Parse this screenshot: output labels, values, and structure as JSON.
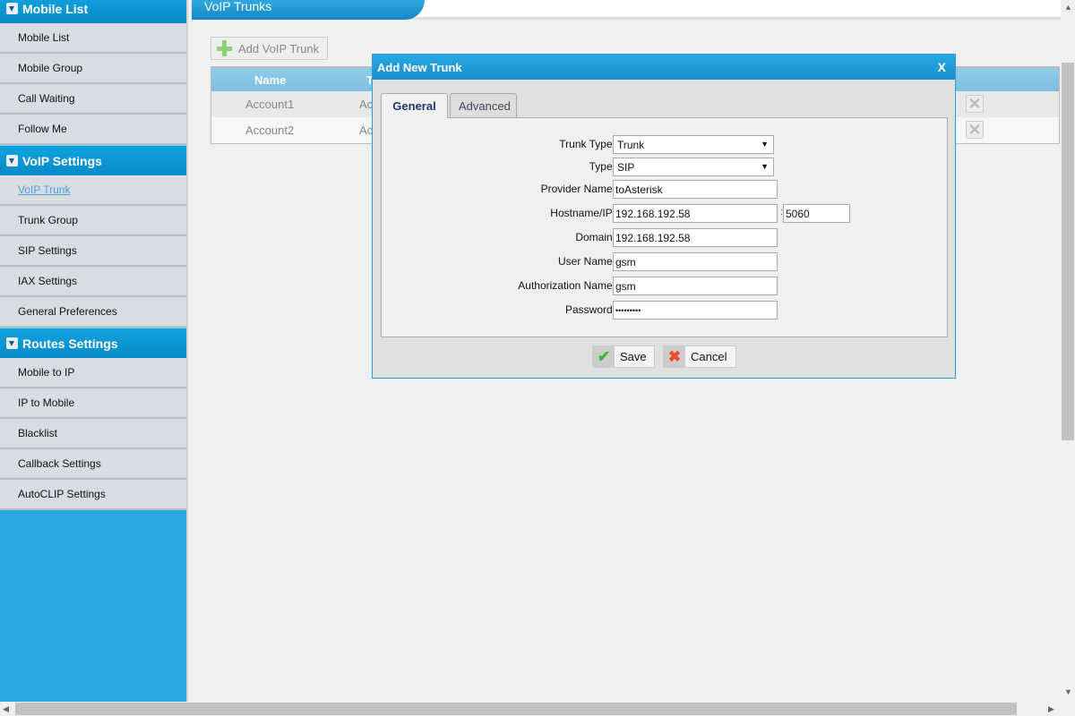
{
  "sidebar": {
    "sections": [
      {
        "title": "Mobile List",
        "items": [
          "Mobile List",
          "Mobile Group",
          "Call Waiting",
          "Follow Me"
        ]
      },
      {
        "title": "VoIP Settings",
        "items": [
          "VoIP Trunk",
          "Trunk Group",
          "SIP Settings",
          "IAX Settings",
          "General Preferences"
        ]
      },
      {
        "title": "Routes Settings",
        "items": [
          "Mobile to IP",
          "IP to Mobile",
          "Blacklist",
          "Callback Settings",
          "AutoCLIP Settings"
        ]
      }
    ],
    "active": "VoIP Trunk"
  },
  "page": {
    "title": "VoIP Trunks",
    "add_button": "Add VoIP Trunk",
    "table": {
      "headers": [
        "Name",
        "T"
      ],
      "rows": [
        [
          "Account1",
          "Ac"
        ],
        [
          "Account2",
          "Ac"
        ]
      ]
    }
  },
  "dialog": {
    "title": "Add New Trunk",
    "close": "X",
    "tabs": [
      "General",
      "Advanced"
    ],
    "fields": {
      "trunk_type_label": "Trunk Type:",
      "trunk_type": "Trunk",
      "type_label": "Type:",
      "type": "SIP",
      "provider_label": "Provider Name:",
      "provider": "toAsterisk",
      "host_label": "Hostname/IP:",
      "host": "192.168.192.58",
      "port": "5060",
      "port_sep": ":",
      "domain_label": "Domain:",
      "domain": "192.168.192.58",
      "user_label": "User Name:",
      "user": "gsm",
      "auth_label": "Authorization Name:",
      "auth": "gsm",
      "password_label": "Password:",
      "password": "•••••••••"
    },
    "save": "Save",
    "cancel": "Cancel"
  },
  "colors": {
    "accent": "#29abe2",
    "header": "#0589c8"
  }
}
